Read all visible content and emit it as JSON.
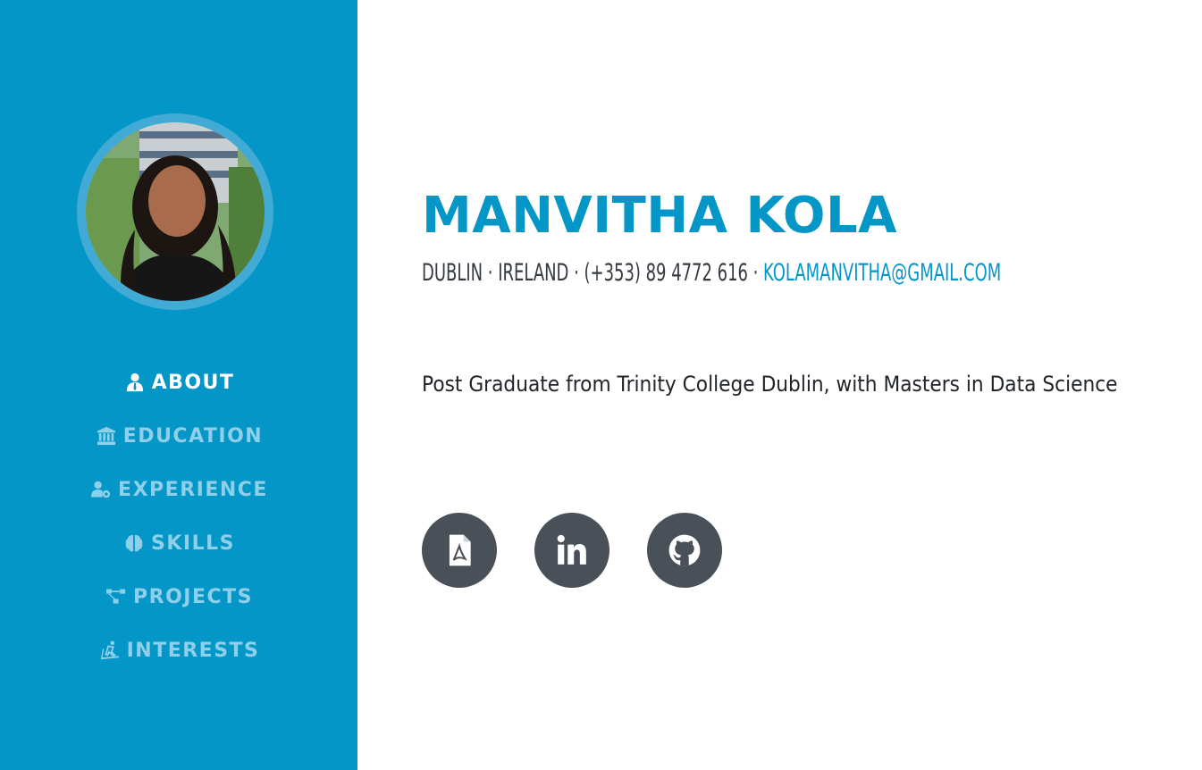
{
  "sidebar": {
    "nav": [
      {
        "label": "ABOUT",
        "icon": "user-tie-icon",
        "active": true
      },
      {
        "label": "EDUCATION",
        "icon": "university-icon",
        "active": false
      },
      {
        "label": "EXPERIENCE",
        "icon": "user-cog-icon",
        "active": false
      },
      {
        "label": "SKILLS",
        "icon": "brain-icon",
        "active": false
      },
      {
        "label": "PROJECTS",
        "icon": "project-diagram-icon",
        "active": false
      },
      {
        "label": "INTERESTS",
        "icon": "skiing-icon",
        "active": false
      }
    ]
  },
  "profile": {
    "name": "MANVITHA KOLA",
    "contact_prefix": "DUBLIN · IRELAND · (+353) 89 4772 616 · ",
    "email": "KOLAMANVITHA@GMAIL.COM",
    "summary": "Post Graduate from Trinity College Dublin, with Masters in Data Science"
  },
  "social": [
    {
      "icon": "file-pdf-icon"
    },
    {
      "icon": "linkedin-icon"
    },
    {
      "icon": "github-icon"
    }
  ],
  "colors": {
    "primary": "#0496c7",
    "nav_inactive": "#8ed0ea",
    "social_bg": "#495057",
    "text_dark": "#343a40"
  }
}
